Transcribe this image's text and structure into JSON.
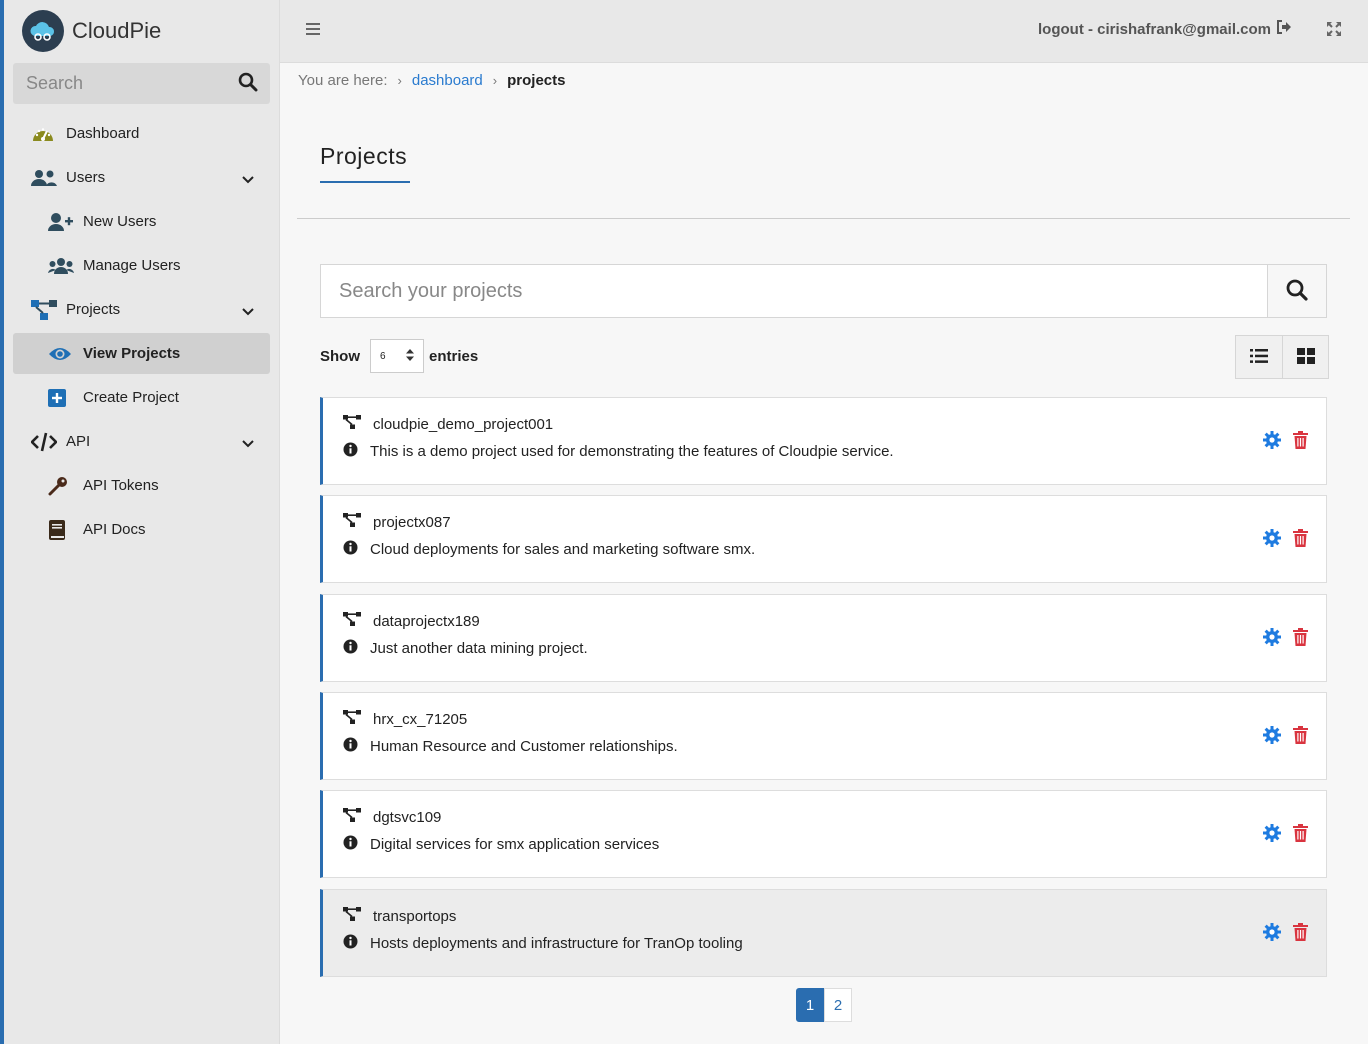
{
  "app": {
    "name": "CloudPie"
  },
  "sidebar": {
    "search_placeholder": "Search",
    "items": [
      {
        "label": "Dashboard",
        "icon": "dashboard-gauge-icon"
      },
      {
        "label": "Users",
        "icon": "users-icon",
        "expandable": true
      },
      {
        "label": "New Users",
        "icon": "user-plus-icon",
        "sub": true
      },
      {
        "label": "Manage Users",
        "icon": "users-group-icon",
        "sub": true
      },
      {
        "label": "Projects",
        "icon": "sitemap-icon",
        "expandable": true
      },
      {
        "label": "View Projects",
        "icon": "eye-icon",
        "sub": true,
        "active": true
      },
      {
        "label": "Create Project",
        "icon": "plus-square-icon",
        "sub": true
      },
      {
        "label": "API",
        "icon": "code-icon",
        "expandable": true
      },
      {
        "label": "API Tokens",
        "icon": "key-icon",
        "sub": true
      },
      {
        "label": "API Docs",
        "icon": "book-icon",
        "sub": true
      }
    ]
  },
  "topbar": {
    "logout_text": "logout - cirishafrank@gmail.com"
  },
  "breadcrumb": {
    "prefix": "You are here:",
    "link": "dashboard",
    "current": "projects"
  },
  "page": {
    "title": "Projects"
  },
  "search": {
    "placeholder": "Search your projects"
  },
  "entries": {
    "show_label": "Show",
    "value": "6",
    "suffix": "entries"
  },
  "projects": [
    {
      "name": "cloudpie_demo_project001",
      "description": "This is a demo project used for demonstrating the features of Cloudpie service."
    },
    {
      "name": "projectx087",
      "description": "Cloud deployments for sales and marketing software smx."
    },
    {
      "name": "dataprojectx189",
      "description": "Just another data mining project."
    },
    {
      "name": "hrx_cx_71205",
      "description": "Human Resource and Customer relationships."
    },
    {
      "name": "dgtsvc109",
      "description": "Digital services for smx application services"
    },
    {
      "name": "transportops",
      "description": "Hosts deployments and infrastructure for TranOp tooling",
      "highlighted": true
    }
  ],
  "pagination": {
    "pages": [
      "1",
      "2"
    ],
    "current": "1"
  },
  "colors": {
    "accent": "#2a6db0",
    "link": "#2a7bcf",
    "gear": "#1e7be0",
    "delete": "#d9343f",
    "sidebar_bg": "#e8e8e8"
  }
}
